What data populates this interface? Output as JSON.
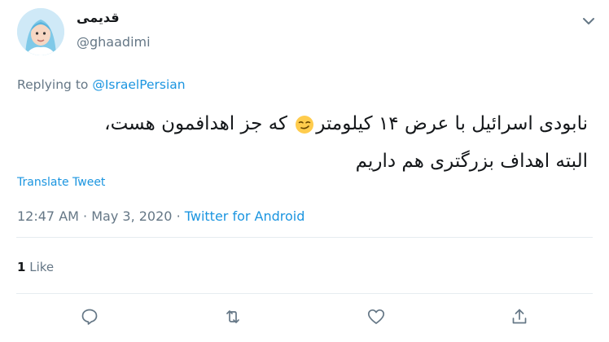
{
  "tweet": {
    "display_name": "قدیمی",
    "handle": "@ghaadimi",
    "replying_label": "Replying to",
    "replying_to": "@IsraelPersian",
    "text_line1_before_emoji": "نابودی اسرائیل با عرض ۱۴ کیلومتر",
    "text_line1_after_emoji": "که جز اهدافمون هست،",
    "text_line2": "البته اهداف بزرگتری هم داریم",
    "emoji": "smirking-face",
    "translate_label": "Translate Tweet",
    "time": "12:47 AM",
    "separator": "·",
    "date": "May 3, 2020",
    "source": "Twitter for Android",
    "likes_count": "1",
    "likes_label": "Like"
  },
  "colors": {
    "link": "#1b95e0",
    "secondary_text": "#657786",
    "emoji_yellow": "#ffcc4d"
  },
  "icons": {
    "caret": "chevron-down-icon",
    "reply": "reply-icon",
    "retweet": "retweet-icon",
    "like": "heart-icon",
    "share": "share-icon"
  }
}
